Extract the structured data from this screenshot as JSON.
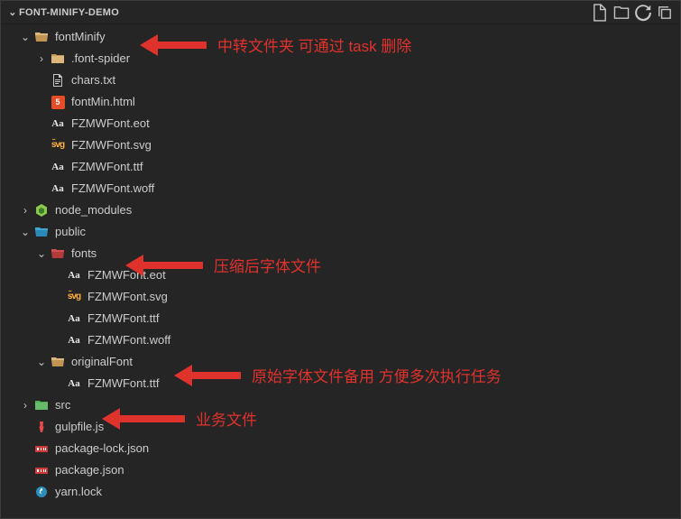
{
  "header": {
    "title": "FONT-MINIFY-DEMO"
  },
  "annotations": {
    "fontMinify": "中转文件夹 可通过 task 删除",
    "fonts": "压缩后字体文件",
    "originalFont": "原始字体文件备用 方便多次执行任务",
    "src": "业务文件"
  },
  "tree": {
    "fontMinify": "fontMinify",
    "fontSpider": ".font-spider",
    "charsTxt": "chars.txt",
    "fontMinHtml": "fontMin.html",
    "eot": "FZMWFont.eot",
    "svg": "FZMWFont.svg",
    "ttf": "FZMWFont.ttf",
    "woff": "FZMWFont.woff",
    "nodeModules": "node_modules",
    "public": "public",
    "fonts": "fonts",
    "fontsEot": "FZMWFont.eot",
    "fontsSvg": "FZMWFont.svg",
    "fontsTtf": "FZMWFont.ttf",
    "fontsWoff": "FZMWFont.woff",
    "originalFont": "originalFont",
    "originalTtf": "FZMWFont.ttf",
    "src": "src",
    "gulpfile": "gulpfile.js",
    "packageLock": "package-lock.json",
    "packageJson": "package.json",
    "yarnLock": "yarn.lock"
  }
}
